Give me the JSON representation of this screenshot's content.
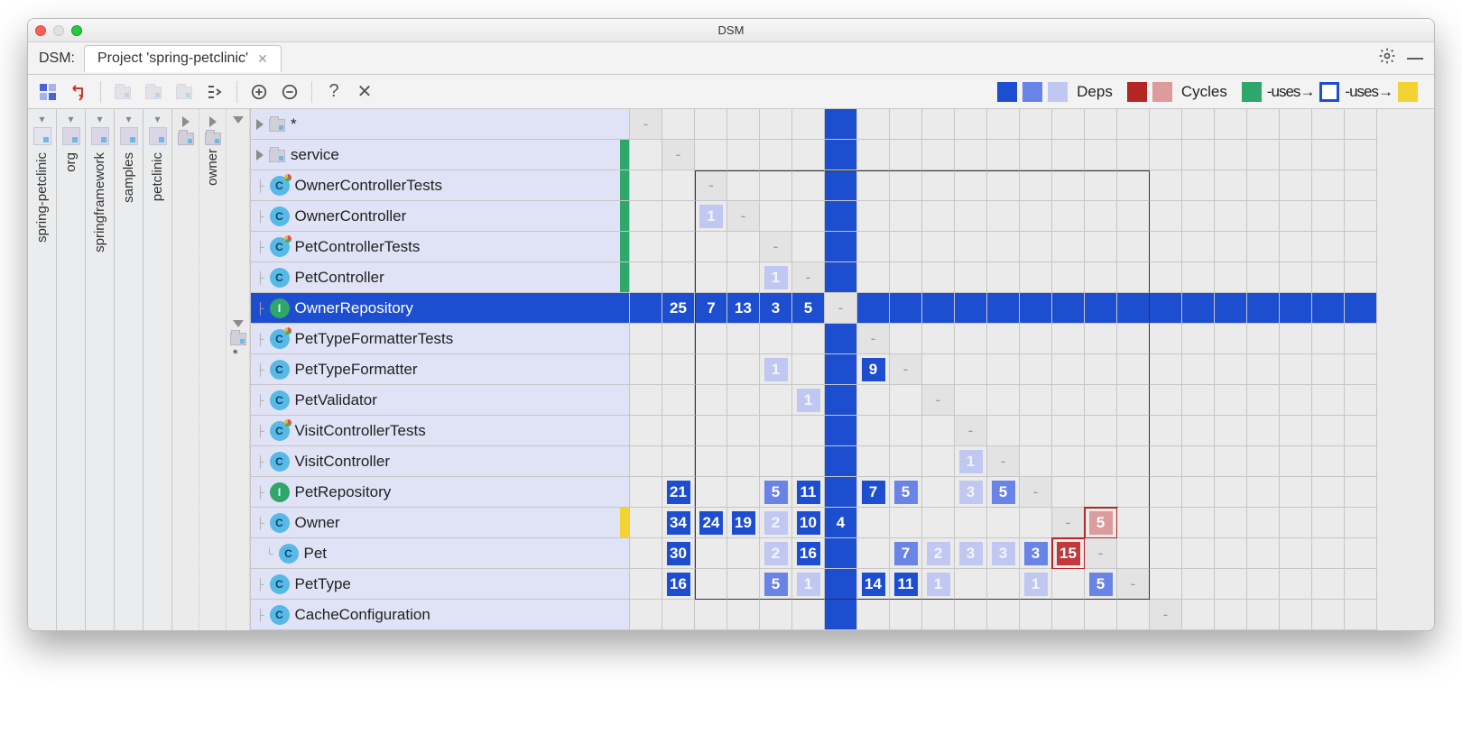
{
  "window": {
    "title": "DSM"
  },
  "tabbar": {
    "label": "DSM:",
    "tab": "Project 'spring-petclinic'"
  },
  "legend": {
    "deps": "Deps",
    "cycles": "Cycles",
    "uses": "-uses→",
    "colors": {
      "dep1": "#1e4ed0",
      "dep2": "#6a83e7",
      "dep3": "#c0c8f2",
      "cyc1": "#b42525",
      "cyc2": "#dd9b9b",
      "green": "#2fa66a",
      "yellow": "#f3d233",
      "selbox": "#1e4ed0"
    }
  },
  "sidepaths": [
    "spring-petclinic",
    "org",
    "springframework",
    "samples",
    "petclinic"
  ],
  "subcols": [
    "owner",
    "*"
  ],
  "rows": [
    {
      "label": "*",
      "kind": "folder",
      "stripe": "",
      "sel": false,
      "c": {
        "0": "-"
      }
    },
    {
      "label": "service",
      "kind": "folder",
      "stripe": "#2fa66a",
      "sel": false,
      "c": {
        "1": "-"
      }
    },
    {
      "label": "OwnerControllerTests",
      "kind": "class test",
      "stripe": "#2fa66a",
      "sel": false,
      "c": {
        "2": "-"
      }
    },
    {
      "label": "OwnerController",
      "kind": "class",
      "stripe": "#2fa66a",
      "sel": false,
      "c": {
        "2": {
          "v": "1",
          "l": "lite"
        },
        "3": "-"
      }
    },
    {
      "label": "PetControllerTests",
      "kind": "class test",
      "stripe": "#2fa66a",
      "sel": false,
      "c": {
        "4": "-"
      }
    },
    {
      "label": "PetController",
      "kind": "class",
      "stripe": "#2fa66a",
      "sel": false,
      "c": {
        "4": {
          "v": "1",
          "l": "lite"
        },
        "5": "-"
      }
    },
    {
      "label": "OwnerRepository",
      "kind": "iface",
      "stripe": "#1e4ed0",
      "sel": true,
      "c": {
        "1": {
          "v": "25",
          "l": "dark"
        },
        "2": {
          "v": "7",
          "l": "dark"
        },
        "3": {
          "v": "13",
          "l": "dark"
        },
        "4": {
          "v": "3",
          "l": "dark"
        },
        "5": {
          "v": "5",
          "l": "dark"
        },
        "6": "-"
      }
    },
    {
      "label": "PetTypeFormatterTests",
      "kind": "class test",
      "stripe": "",
      "sel": false,
      "c": {
        "7": "-"
      }
    },
    {
      "label": "PetTypeFormatter",
      "kind": "class",
      "stripe": "",
      "sel": false,
      "c": {
        "4": {
          "v": "1",
          "l": "lite"
        },
        "7": {
          "v": "9",
          "l": "dark"
        },
        "8": "-"
      }
    },
    {
      "label": "PetValidator",
      "kind": "class",
      "stripe": "",
      "sel": false,
      "c": {
        "5": {
          "v": "1",
          "l": "lite"
        },
        "9": "-"
      }
    },
    {
      "label": "VisitControllerTests",
      "kind": "class test",
      "stripe": "",
      "sel": false,
      "c": {
        "10": "-"
      }
    },
    {
      "label": "VisitController",
      "kind": "class",
      "stripe": "",
      "sel": false,
      "c": {
        "10": {
          "v": "1",
          "l": "lite"
        },
        "11": "-"
      }
    },
    {
      "label": "PetRepository",
      "kind": "iface",
      "stripe": "",
      "sel": false,
      "c": {
        "1": {
          "v": "21",
          "l": "dark"
        },
        "4": {
          "v": "5",
          "l": "mid"
        },
        "5": {
          "v": "11",
          "l": "dark"
        },
        "7": {
          "v": "7",
          "l": "dark"
        },
        "8": {
          "v": "5",
          "l": "mid"
        },
        "10": {
          "v": "3",
          "l": "lite"
        },
        "11": {
          "v": "5",
          "l": "mid"
        },
        "12": "-"
      }
    },
    {
      "label": "Owner",
      "kind": "class",
      "stripe": "#f3d233",
      "sel": false,
      "c": {
        "1": {
          "v": "34",
          "l": "dark"
        },
        "2": {
          "v": "24",
          "l": "dark"
        },
        "3": {
          "v": "19",
          "l": "dark"
        },
        "4": {
          "v": "2",
          "l": "lite"
        },
        "5": {
          "v": "10",
          "l": "dark"
        },
        "6": {
          "v": "4",
          "l": "dark"
        },
        "13": "-",
        "14": {
          "v": "5",
          "l": "red-lite",
          "cycle": true
        }
      }
    },
    {
      "label": "Pet",
      "kind": "class",
      "stripe": "",
      "sel": false,
      "indent": true,
      "c": {
        "1": {
          "v": "30",
          "l": "dark"
        },
        "4": {
          "v": "2",
          "l": "lite"
        },
        "5": {
          "v": "16",
          "l": "dark"
        },
        "8": {
          "v": "7",
          "l": "mid"
        },
        "9": {
          "v": "2",
          "l": "lite"
        },
        "10": {
          "v": "3",
          "l": "lite"
        },
        "11": {
          "v": "3",
          "l": "lite"
        },
        "12": {
          "v": "3",
          "l": "mid"
        },
        "13": {
          "v": "15",
          "l": "red-dark",
          "cycle": true
        },
        "14": "-"
      }
    },
    {
      "label": "PetType",
      "kind": "class",
      "stripe": "",
      "sel": false,
      "c": {
        "1": {
          "v": "16",
          "l": "dark"
        },
        "4": {
          "v": "5",
          "l": "mid"
        },
        "5": {
          "v": "1",
          "l": "lite"
        },
        "7": {
          "v": "14",
          "l": "dark"
        },
        "8": {
          "v": "11",
          "l": "dark"
        },
        "9": {
          "v": "1",
          "l": "lite"
        },
        "12": {
          "v": "1",
          "l": "lite"
        },
        "14": {
          "v": "5",
          "l": "mid"
        },
        "15": "-"
      }
    },
    {
      "label": "CacheConfiguration",
      "kind": "class",
      "stripe": "",
      "sel": false,
      "c": {
        "16": "-"
      }
    }
  ],
  "num_cols": 23,
  "selected_col": 6,
  "inner_box": {
    "row_start": 2,
    "row_end": 15,
    "col_start": 2,
    "col_end": 15
  }
}
